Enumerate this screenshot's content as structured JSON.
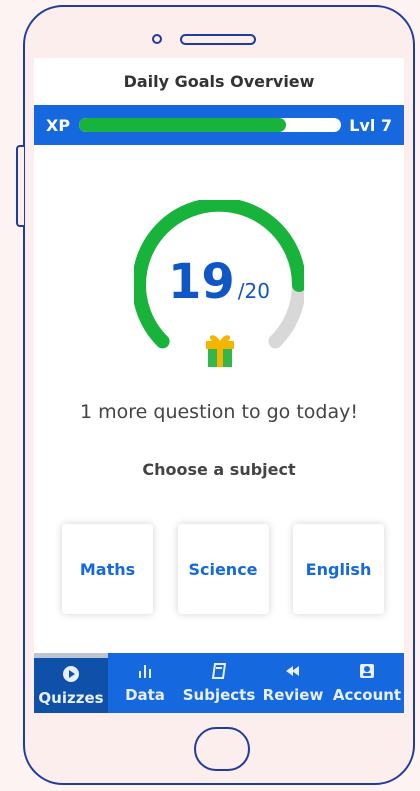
{
  "header": {
    "title": "Daily Goals Overview"
  },
  "xp": {
    "label": "XP",
    "level": "Lvl 7",
    "progress_percent": 79
  },
  "goal": {
    "current": "19",
    "target": "/20",
    "message": "1 more question to go today!"
  },
  "subjects": {
    "heading": "Choose a subject",
    "items": [
      "Maths",
      "Science",
      "English"
    ]
  },
  "nav": {
    "items": [
      {
        "label": "Quizzes",
        "icon": "play-icon"
      },
      {
        "label": "Data",
        "icon": "bar-chart-icon"
      },
      {
        "label": "Subjects",
        "icon": "book-icon"
      },
      {
        "label": "Review",
        "icon": "rewind-icon"
      },
      {
        "label": "Account",
        "icon": "person-icon"
      }
    ]
  },
  "colors": {
    "brand_blue": "#1568DD",
    "nav_active": "#0F50A9",
    "progress_green": "#18B33A",
    "ring_grey": "#D8D8D8",
    "gift_green": "#32B74A",
    "gift_gold": "#F4B400",
    "phone_outline": "#1F3C9E",
    "background": "#FDF3F3"
  }
}
